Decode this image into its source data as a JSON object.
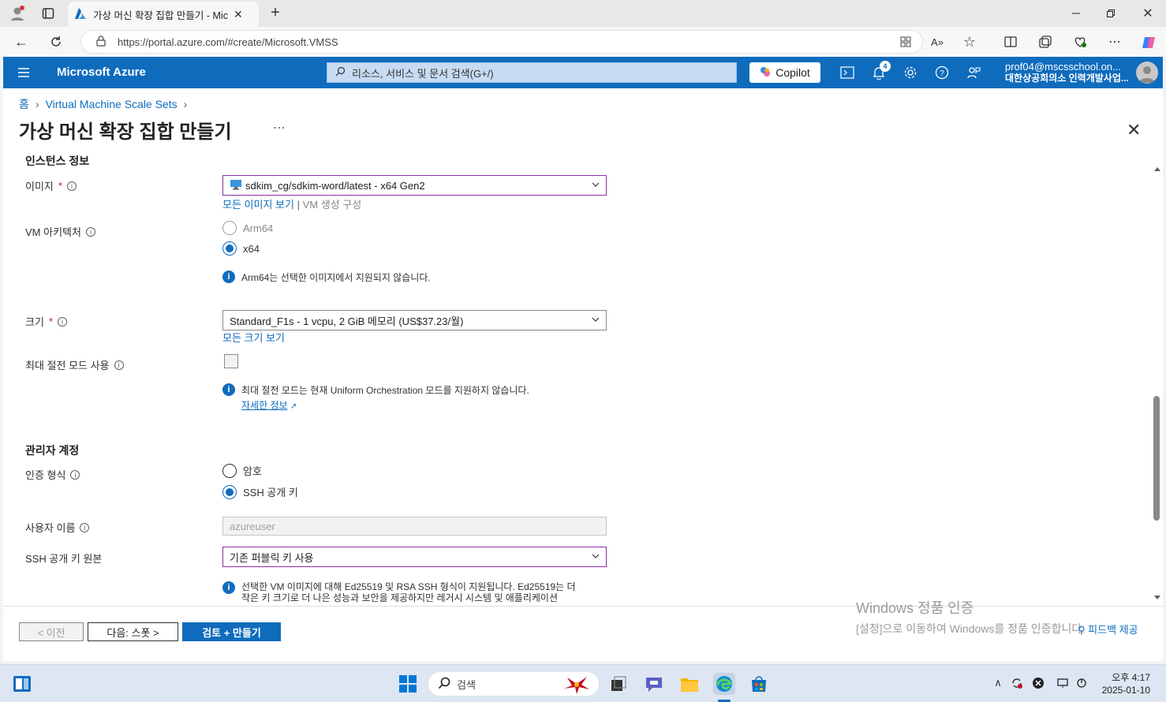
{
  "browser": {
    "tab_title": "가상 머신 확장 집합 만들기 - Mic",
    "url": "https://portal.azure.com/#create/Microsoft.VMSS"
  },
  "azure_header": {
    "brand": "Microsoft Azure",
    "search_placeholder": "리소스, 서비스 및 문서 검색(G+/)",
    "copilot_label": "Copilot",
    "notification_count": "4",
    "account_email": "prof04@mscsschool.on...",
    "account_org": "대한상공회의소 인력개발사업..."
  },
  "breadcrumb": {
    "home": "홈",
    "vmss": "Virtual Machine Scale Sets"
  },
  "page": {
    "title": "가상 머신 확장 집합 만들기",
    "cut_section": "인스턴스 정보"
  },
  "form": {
    "image_label": "이미지",
    "required_mark": "*",
    "image_value": "sdkim_cg/sdkim-word/latest - x64 Gen2",
    "see_all_images": "모든 이미지 보기",
    "link_sep": "|",
    "vm_config": "VM 생성 구성",
    "arch_label": "VM 아키텍처",
    "arch_options": [
      "Arm64",
      "x64"
    ],
    "arch_info": "Arm64는 선택한 이미지에서 지원되지 않습니다.",
    "size_label": "크기",
    "size_value": "Standard_F1s - 1 vcpu, 2 GiB 메모리 (US$37.23/월)",
    "see_all_sizes": "모든 크기 보기",
    "spot_label": "최대 절전 모드 사용",
    "spot_info": "최대 절전 모드는 현재 Uniform Orchestration 모드를 지원하지 않습니다.",
    "learn_more": "자세한 정보",
    "admin_section": "관리자 계정",
    "auth_label": "인증 형식",
    "auth_options": [
      "암호",
      "SSH 공개 키"
    ],
    "username_label": "사용자 이름",
    "username_value": "azureuser",
    "ssh_source_label": "SSH 공개 키 원본",
    "ssh_source_value": "기존 퍼블릭 키 사용",
    "ssh_info_line1": "선택한 VM 이미지에 대해 Ed25519 및 RSA SSH 형식이 지원됩니다. Ed25519는 더",
    "ssh_info_line2": "작은 키 크기로 더 나은 성능과 보안을 제공하지만 레거시 시스템 및 애플리케이션"
  },
  "footer": {
    "prev": "< 이전",
    "next": "다음: 스폿 >",
    "review": "검토 + 만들기",
    "feedback": "피드백 제공"
  },
  "watermark": {
    "line1": "Windows 정품 인증",
    "line2": "[설정]으로 이동하여 Windows를 정품 인증합니다."
  },
  "taskbar": {
    "search": "검색",
    "time": "오후 4:17",
    "date": "2025-01-10"
  },
  "colors": {
    "azure_blue": "#0f6cbd",
    "primary_button": "#0f6cbd"
  }
}
